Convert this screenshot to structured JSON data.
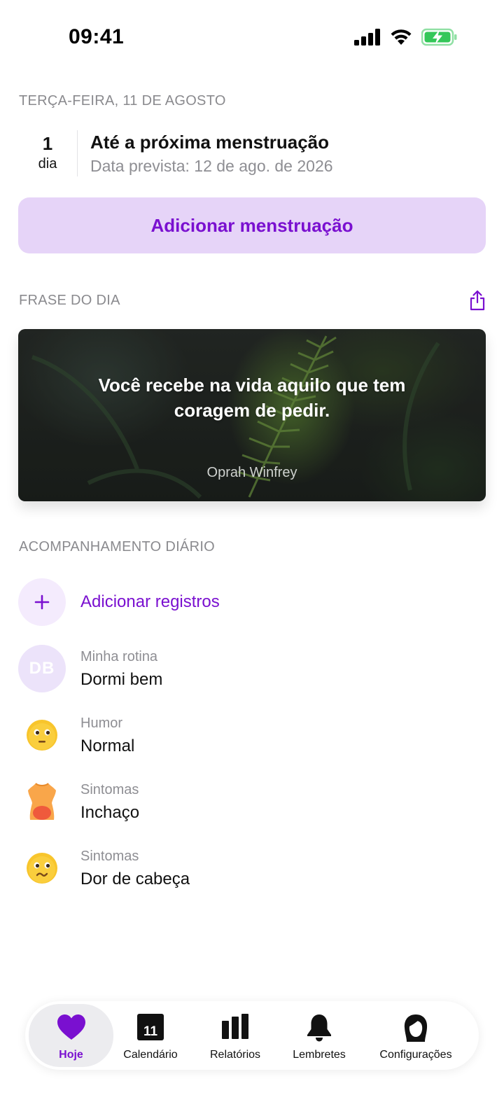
{
  "status_bar": {
    "time": "09:41",
    "icons": [
      "cellular-signal-icon",
      "wifi-icon",
      "battery-charging-icon"
    ],
    "battery_color": "#34c759"
  },
  "date_header": "TERÇA-FEIRA, 11 DE AGOSTO",
  "cycle": {
    "count": "1",
    "unit": "dia",
    "title": "Até a próxima menstruação",
    "subtitle": "Data prevista: 12 de ago. de 2026"
  },
  "add_period_button": "Adicionar menstruação",
  "quote_section": {
    "header": "FRASE DO DIA",
    "share_icon": "share-icon",
    "text": "Você recebe na vida aquilo que tem coragem de pedir.",
    "author": "Oprah Winfrey"
  },
  "tracking": {
    "header": "ACOMPANHAMENTO DIÁRIO",
    "add_label": "Adicionar registros",
    "entries": [
      {
        "label": "Minha rotina",
        "value": "Dormi bem",
        "icon": "avatar-initials",
        "initials": "DB"
      },
      {
        "label": "Humor",
        "value": "Normal",
        "icon": "neutral-face-icon"
      },
      {
        "label": "Sintomas",
        "value": "Inchaço",
        "icon": "bloating-body-icon"
      },
      {
        "label": "Sintomas",
        "value": "Dor de cabeça",
        "icon": "headache-face-icon"
      }
    ]
  },
  "tab_bar": {
    "tabs": [
      {
        "label": "Hoje",
        "icon": "heart-icon",
        "active": true
      },
      {
        "label": "Calendário",
        "icon": "calendar-icon",
        "badge": "11"
      },
      {
        "label": "Relatórios",
        "icon": "bar-chart-icon"
      },
      {
        "label": "Lembretes",
        "icon": "bell-icon"
      },
      {
        "label": "Configurações",
        "icon": "profile-icon"
      }
    ]
  },
  "colors": {
    "accent": "#7a10d0",
    "accent_light": "#e6d4f8",
    "secondary_text": "#8e8e93"
  }
}
